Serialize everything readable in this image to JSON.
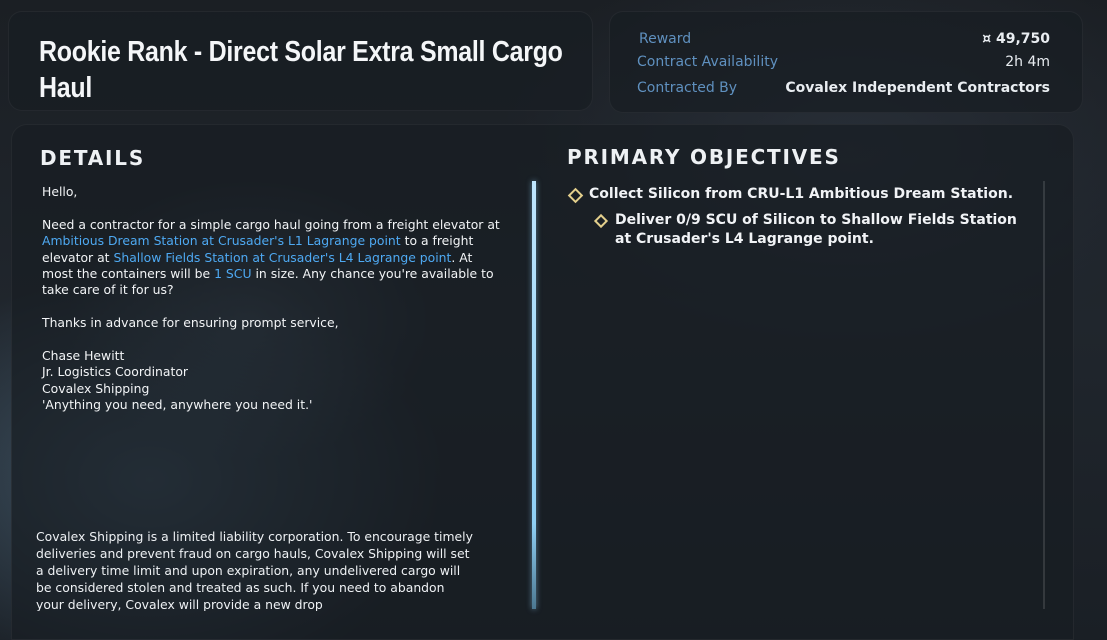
{
  "contract": {
    "title": "Rookie Rank - Direct Solar Extra Small Cargo Haul"
  },
  "info": {
    "reward_label": "Reward",
    "reward_value": "¤ 49,750",
    "availability_label": "Contract Availability",
    "availability_value": "2h 4m",
    "contracted_by_label": "Contracted By",
    "contracted_by_value": "Covalex Independent Contractors"
  },
  "details": {
    "heading": "DETAILS",
    "greeting": "Hello,",
    "para1": [
      "Need a contractor for a simple cargo haul going from a freight elevator at ",
      "Ambitious Dream Station at Crusader's L1 Lagrange point",
      " to a freight elevator at ",
      "Shallow Fields Station at Crusader's L4 Lagrange point",
      ". At most the containers will be ",
      "1 SCU",
      " in size. Any chance you're available to take care of it for us?"
    ],
    "para2": "Thanks in advance for ensuring prompt service,",
    "signature": [
      "Chase Hewitt",
      "Jr. Logistics Coordinator",
      "Covalex Shipping",
      "'Anything you need, anywhere you need it.'"
    ],
    "legal": "Covalex Shipping is a limited liability corporation. To encourage timely deliveries and prevent fraud on cargo hauls, Covalex Shipping will set a delivery time limit and upon expiration, any undelivered cargo will be considered stolen and treated as such. If you need to abandon your delivery, Covalex will provide a new drop"
  },
  "objectives": {
    "heading": "PRIMARY OBJECTIVES",
    "items": [
      {
        "text": "Collect Silicon from CRU-L1 Ambitious Dream Station."
      },
      {
        "text": "Deliver 0/9 SCU of Silicon to Shallow Fields Station at Crusader's L4 Lagrange point."
      }
    ]
  },
  "colors": {
    "link": "#4ea9f2",
    "label": "#5f90bf",
    "objective_marker": "#e3cf8c",
    "scroll_accent": "#8fd0f5"
  }
}
